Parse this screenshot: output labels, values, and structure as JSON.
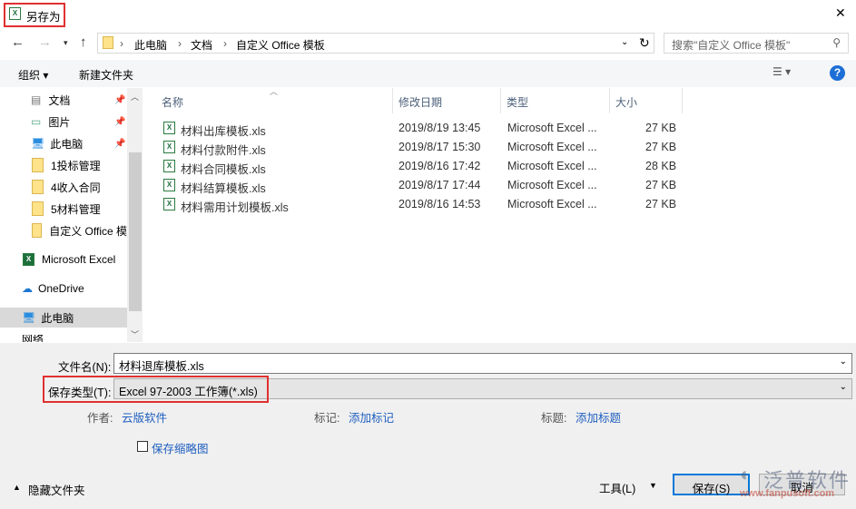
{
  "window": {
    "title": "另存为",
    "close": "✕"
  },
  "nav": {
    "back": "←",
    "forward": "→",
    "up": "↑",
    "path": [
      "此电脑",
      "文档",
      "自定义 Office 模板"
    ],
    "refresh": "↻",
    "search_placeholder": "搜索\"自定义 Office 模板\""
  },
  "toolbar": {
    "organize": "组织 ▾",
    "new_folder": "新建文件夹",
    "help": "?"
  },
  "sidebar": {
    "items": [
      {
        "label": "文档",
        "icon": "document-icon",
        "pinned": true
      },
      {
        "label": "图片",
        "icon": "picture-icon",
        "pinned": true
      },
      {
        "label": "此电脑",
        "icon": "computer-icon",
        "pinned": true
      },
      {
        "label": "1投标管理",
        "icon": "folder-icon"
      },
      {
        "label": "4收入合同",
        "icon": "folder-icon"
      },
      {
        "label": "5材料管理",
        "icon": "folder-icon"
      },
      {
        "label": "自定义 Office 模",
        "icon": "folder-icon"
      },
      {
        "label": "Microsoft Excel",
        "icon": "excel-icon"
      },
      {
        "label": "OneDrive",
        "icon": "cloud-icon"
      },
      {
        "label": "此电脑",
        "icon": "computer-icon"
      },
      {
        "label": "网络",
        "icon": "network-icon"
      }
    ]
  },
  "columns": [
    "名称",
    "修改日期",
    "类型",
    "大小"
  ],
  "files": [
    {
      "name": "材料出库模板.xls",
      "date": "2019/8/19 13:45",
      "type": "Microsoft Excel ...",
      "size": "27 KB"
    },
    {
      "name": "材料付款附件.xls",
      "date": "2019/8/17 15:30",
      "type": "Microsoft Excel ...",
      "size": "27 KB"
    },
    {
      "name": "材料合同模板.xls",
      "date": "2019/8/16 17:42",
      "type": "Microsoft Excel ...",
      "size": "28 KB"
    },
    {
      "name": "材料结算模板.xls",
      "date": "2019/8/17 17:44",
      "type": "Microsoft Excel ...",
      "size": "27 KB"
    },
    {
      "name": "材料需用计划模板.xls",
      "date": "2019/8/16 14:53",
      "type": "Microsoft Excel ...",
      "size": "27 KB"
    }
  ],
  "form": {
    "filename_label": "文件名(N):",
    "filename": "材料退库模板.xls",
    "type_label": "保存类型(T):",
    "type": "Excel 97-2003 工作簿(*.xls)",
    "author_label": "作者:",
    "author": "云版软件",
    "tags_label": "标记:",
    "tags": "添加标记",
    "title_label": "标题:",
    "title": "添加标题",
    "thumb_label": "保存缩略图"
  },
  "footer": {
    "hide_folders": "隐藏文件夹",
    "tools": "工具(L)",
    "save": "保存(S)",
    "cancel": "取消"
  },
  "watermark": {
    "brand": "泛普软件",
    "url": "www.fanpusoft.com"
  }
}
